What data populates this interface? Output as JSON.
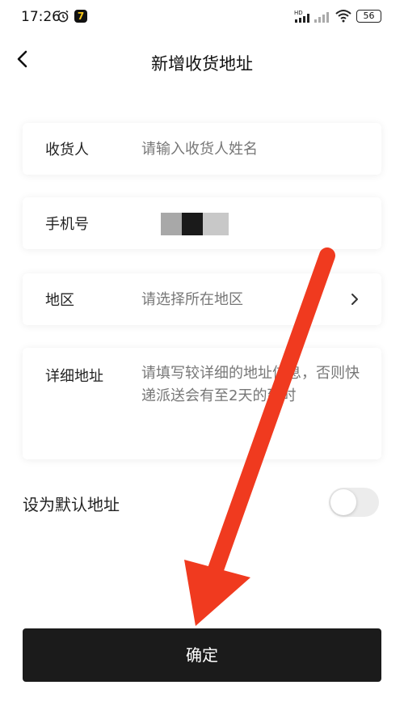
{
  "status_bar": {
    "time": "17:26",
    "battery": "56",
    "icons": [
      "alarm-icon",
      "app-badge-icon",
      "signal-hd-icon",
      "signal-icon",
      "wifi-icon",
      "battery-icon"
    ],
    "app_badge_glyph": "7"
  },
  "header": {
    "title": "新增收货地址",
    "back_icon": "chevron-left-icon"
  },
  "form": {
    "consignee": {
      "label": "收货人",
      "placeholder": "请输入收货人姓名",
      "value": ""
    },
    "phone": {
      "label": "手机号",
      "value_masked": true
    },
    "region": {
      "label": "地区",
      "placeholder": "请选择所在地区",
      "icon": "chevron-right-icon"
    },
    "address": {
      "label": "详细地址",
      "placeholder": "请填写较详细的地址信息，否则快递派送会有至2天的延时"
    }
  },
  "default_address": {
    "label": "设为默认地址",
    "enabled": false
  },
  "confirm_button": {
    "label": "确定"
  },
  "colors": {
    "button_bg": "#1b1b1b",
    "arrow": "#f03a1f",
    "toggle_off": "#ececec"
  }
}
